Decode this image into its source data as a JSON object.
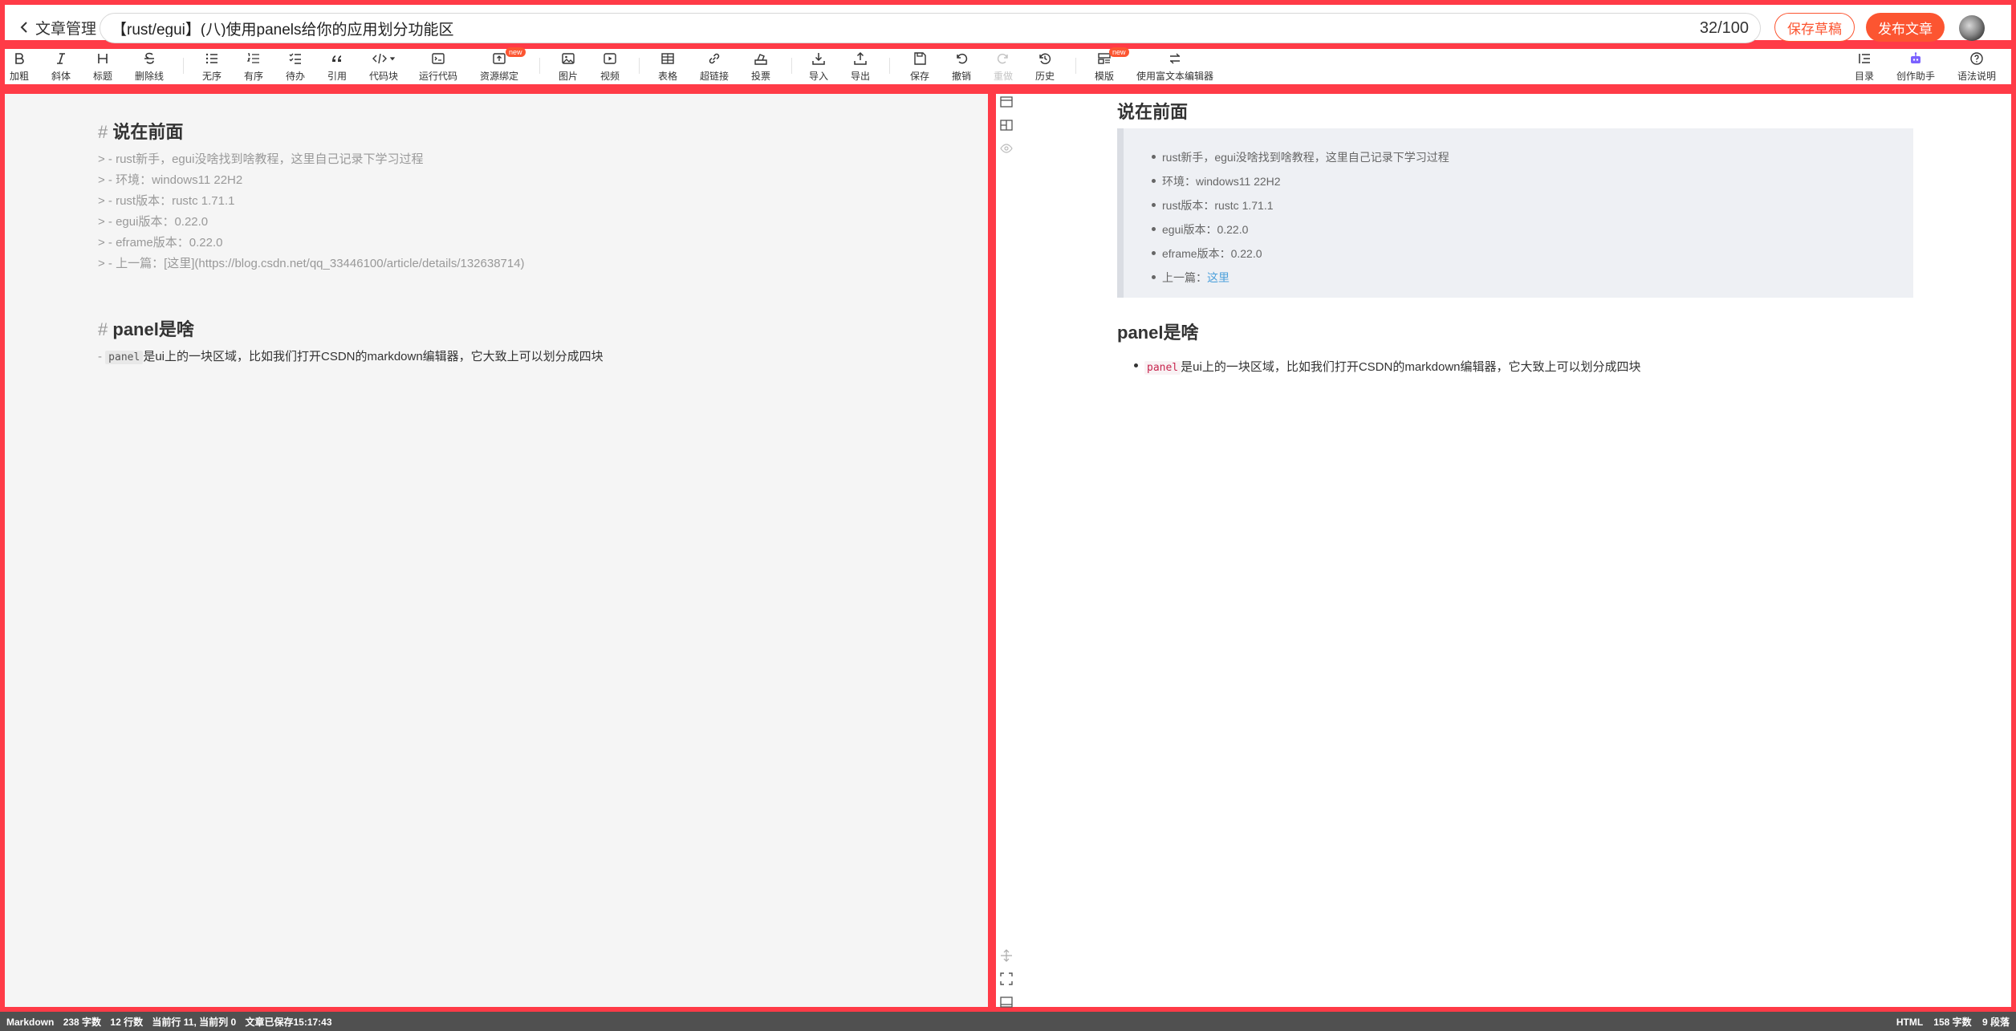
{
  "topbar": {
    "back_label": "文章管理",
    "title_value": "【rust/egui】(八)使用panels给你的应用划分功能区",
    "title_count": "32/100",
    "save_draft_label": "保存草稿",
    "publish_label": "发布文章"
  },
  "toolbar": {
    "bold": "加粗",
    "italic": "斜体",
    "heading": "标题",
    "strike": "删除线",
    "ul": "无序",
    "ol": "有序",
    "todo": "待办",
    "quote": "引用",
    "codeblock": "代码块",
    "runcode": "运行代码",
    "resource": "资源绑定",
    "image": "图片",
    "video": "视频",
    "table": "表格",
    "link": "超链接",
    "vote": "投票",
    "import": "导入",
    "export": "导出",
    "save": "保存",
    "undo": "撤销",
    "redo": "重做",
    "history": "历史",
    "template": "模版",
    "richtext": "使用富文本编辑器",
    "toc": "目录",
    "assistant": "创作助手",
    "syntax": "语法说明",
    "badge_new": "new"
  },
  "editor": {
    "h1_hash": "#",
    "h1_text": "说在前面",
    "lines": [
      "> - rust新手，egui没啥找到啥教程，这里自己记录下学习过程",
      "> - 环境：windows11 22H2",
      "> - rust版本：rustc 1.71.1",
      "> - egui版本：0.22.0",
      "> - eframe版本：0.22.0",
      "> - 上一篇：[这里](https://blog.csdn.net/qq_33446100/article/details/132638714)"
    ],
    "h2_hash": "#",
    "h2_text": "panel是啥",
    "body_prefix": "- ",
    "body_code": "panel",
    "body_text": "是ui上的一块区域，比如我们打开CSDN的markdown编辑器，它大致上可以划分成四块"
  },
  "preview": {
    "h1": "说在前面",
    "items": [
      "rust新手，egui没啥找到啥教程，这里自己记录下学习过程",
      "环境：windows11 22H2",
      "rust版本：rustc 1.71.1",
      "egui版本：0.22.0",
      "eframe版本：0.22.0"
    ],
    "prev_prefix": "上一篇：",
    "prev_link": "这里",
    "h2": "panel是啥",
    "body_code": "panel",
    "body_text": "是ui上的一块区域，比如我们打开CSDN的markdown编辑器，它大致上可以划分成四块"
  },
  "status": {
    "mode": "Markdown",
    "chars": "238 字数",
    "lines": "12 行数",
    "cursor": "当前行 11, 当前列 0",
    "saved": "文章已保存15:17:43",
    "html": "HTML",
    "html_chars": "158 字数",
    "paragraphs": "9 段落"
  }
}
